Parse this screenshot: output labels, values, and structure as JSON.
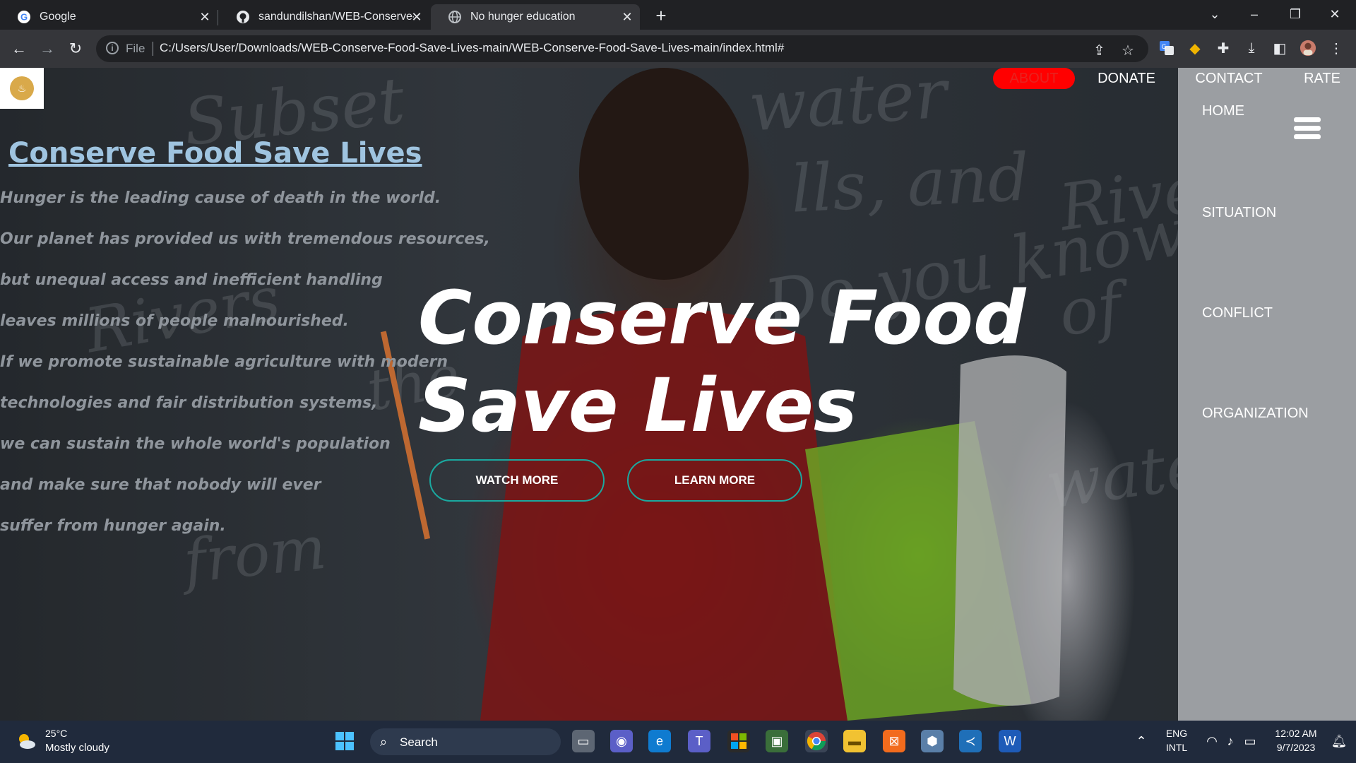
{
  "browser": {
    "tabs": [
      {
        "title": "Google",
        "icon": "google-icon"
      },
      {
        "title": "sandundilshan/WEB-Conserve-Fc",
        "icon": "github-icon"
      },
      {
        "title": "No hunger education",
        "icon": "globe-icon",
        "active": true
      }
    ],
    "new_tab": "+",
    "address": {
      "scheme_label": "File",
      "url": "C:/Users/User/Downloads/WEB-Conserve-Food-Save-Lives-main/WEB-Conserve-Food-Save-Lives-main/index.html#"
    }
  },
  "site": {
    "logo_text": "♨",
    "top_nav": [
      "ABOUT",
      "DONATE",
      "CONTACT",
      "RATE"
    ],
    "side_nav": [
      "HOME",
      "SITUATION",
      "CONFLICT",
      "ORGANIZATION"
    ],
    "left_title": "Conserve Food Save Lives",
    "left_lines": [
      "Hunger is the leading cause of death in the world.",
      "Our planet has provided us with tremendous resources,",
      "but unequal access and inefficient handling",
      "leaves millions of people malnourished.",
      "If we promote sustainable agriculture with modern",
      "technologies and fair distribution systems,",
      "we can sustain the whole world's population",
      "and make sure that nobody will ever",
      "suffer from hunger again."
    ],
    "hero_title_line1": "Conserve Food",
    "hero_title_line2": "Save Lives",
    "buttons": {
      "watch": "WATCH MORE",
      "learn": "LEARN MORE"
    },
    "chalk": [
      "Subset",
      "water",
      "lls, and",
      "Do you know",
      "River",
      "of",
      "water",
      "from",
      "the",
      "Rivers"
    ],
    "colors": {
      "accent_red": "#ff0000",
      "button_border": "#1aa9a0",
      "sidebar": "#9b9ea2",
      "title_blue": "#9fc4e0"
    }
  },
  "taskbar": {
    "weather_temp": "25°C",
    "weather_desc": "Mostly cloudy",
    "search_label": "Search",
    "lang_top": "ENG",
    "lang_bottom": "INTL",
    "time": "12:02 AM",
    "date": "9/7/2023"
  }
}
